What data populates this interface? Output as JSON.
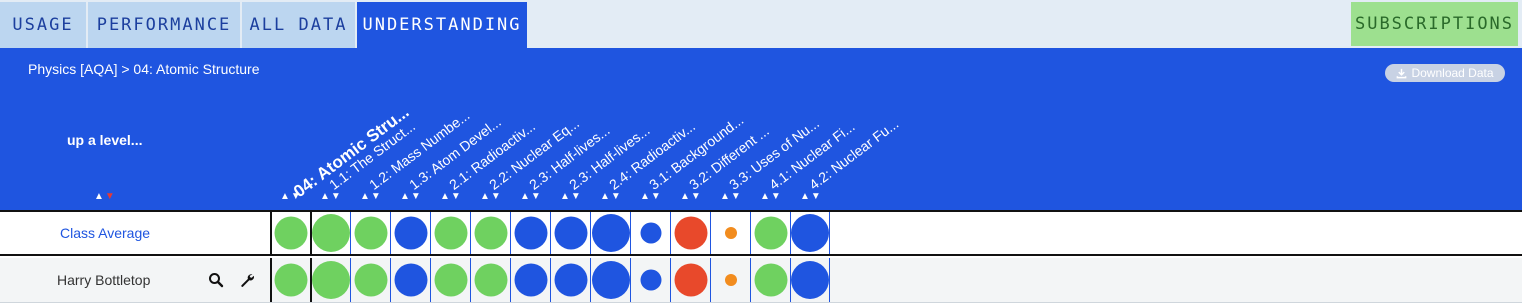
{
  "tabs": [
    {
      "label": "USAGE",
      "active": false
    },
    {
      "label": "PERFORMANCE",
      "active": false
    },
    {
      "label": "ALL DATA",
      "active": false
    },
    {
      "label": "UNDERSTANDING",
      "active": true
    }
  ],
  "subscriptions_label": "SUBSCRIPTIONS",
  "breadcrumb": "Physics [AQA] > 04: Atomic Structure",
  "download_label": "Download Data",
  "up_level_label": "up a level...",
  "sort_up": "▲",
  "sort_down": "▼",
  "columns": [
    "04: Atomic Stru...",
    "1.1: The Struct...",
    "1.2: Mass Numbe...",
    "1.3: Atom Devel...",
    "2.1: Radioactiv...",
    "2.2: Nuclear Eq...",
    "2.3: Half-lives...",
    "2.3: Half-lives...",
    "2.4: Radioactiv...",
    "3.1: Background...",
    "3.2: Different ...",
    "3.3: Uses of Nu...",
    "4.1: Nuclear Fi...",
    "4.2: Nuclear Fu..."
  ],
  "colors": {
    "green": "#6fd160",
    "blue": "#1f55e0",
    "red": "#e8492b",
    "orange": "#f28c1e"
  },
  "rows": [
    {
      "label": "Class Average",
      "cells": [
        {
          "color": "green",
          "size": "m"
        },
        {
          "color": "green",
          "size": "l"
        },
        {
          "color": "green",
          "size": "m"
        },
        {
          "color": "blue",
          "size": "m"
        },
        {
          "color": "green",
          "size": "m"
        },
        {
          "color": "green",
          "size": "m"
        },
        {
          "color": "blue",
          "size": "m"
        },
        {
          "color": "blue",
          "size": "m"
        },
        {
          "color": "blue",
          "size": "l"
        },
        {
          "color": "blue",
          "size": "s"
        },
        {
          "color": "red",
          "size": "m"
        },
        {
          "color": "orange",
          "size": "xs"
        },
        {
          "color": "green",
          "size": "m"
        },
        {
          "color": "blue",
          "size": "l"
        }
      ]
    },
    {
      "label": "Harry Bottletop",
      "cells": [
        {
          "color": "green",
          "size": "m"
        },
        {
          "color": "green",
          "size": "l"
        },
        {
          "color": "green",
          "size": "m"
        },
        {
          "color": "blue",
          "size": "m"
        },
        {
          "color": "green",
          "size": "m"
        },
        {
          "color": "green",
          "size": "m"
        },
        {
          "color": "blue",
          "size": "m"
        },
        {
          "color": "blue",
          "size": "m"
        },
        {
          "color": "blue",
          "size": "l"
        },
        {
          "color": "blue",
          "size": "s"
        },
        {
          "color": "red",
          "size": "m"
        },
        {
          "color": "orange",
          "size": "xs"
        },
        {
          "color": "green",
          "size": "m"
        },
        {
          "color": "blue",
          "size": "l"
        }
      ]
    }
  ],
  "icons": {
    "search": "search-icon",
    "wrench": "wrench-icon",
    "download": "download-icon"
  }
}
